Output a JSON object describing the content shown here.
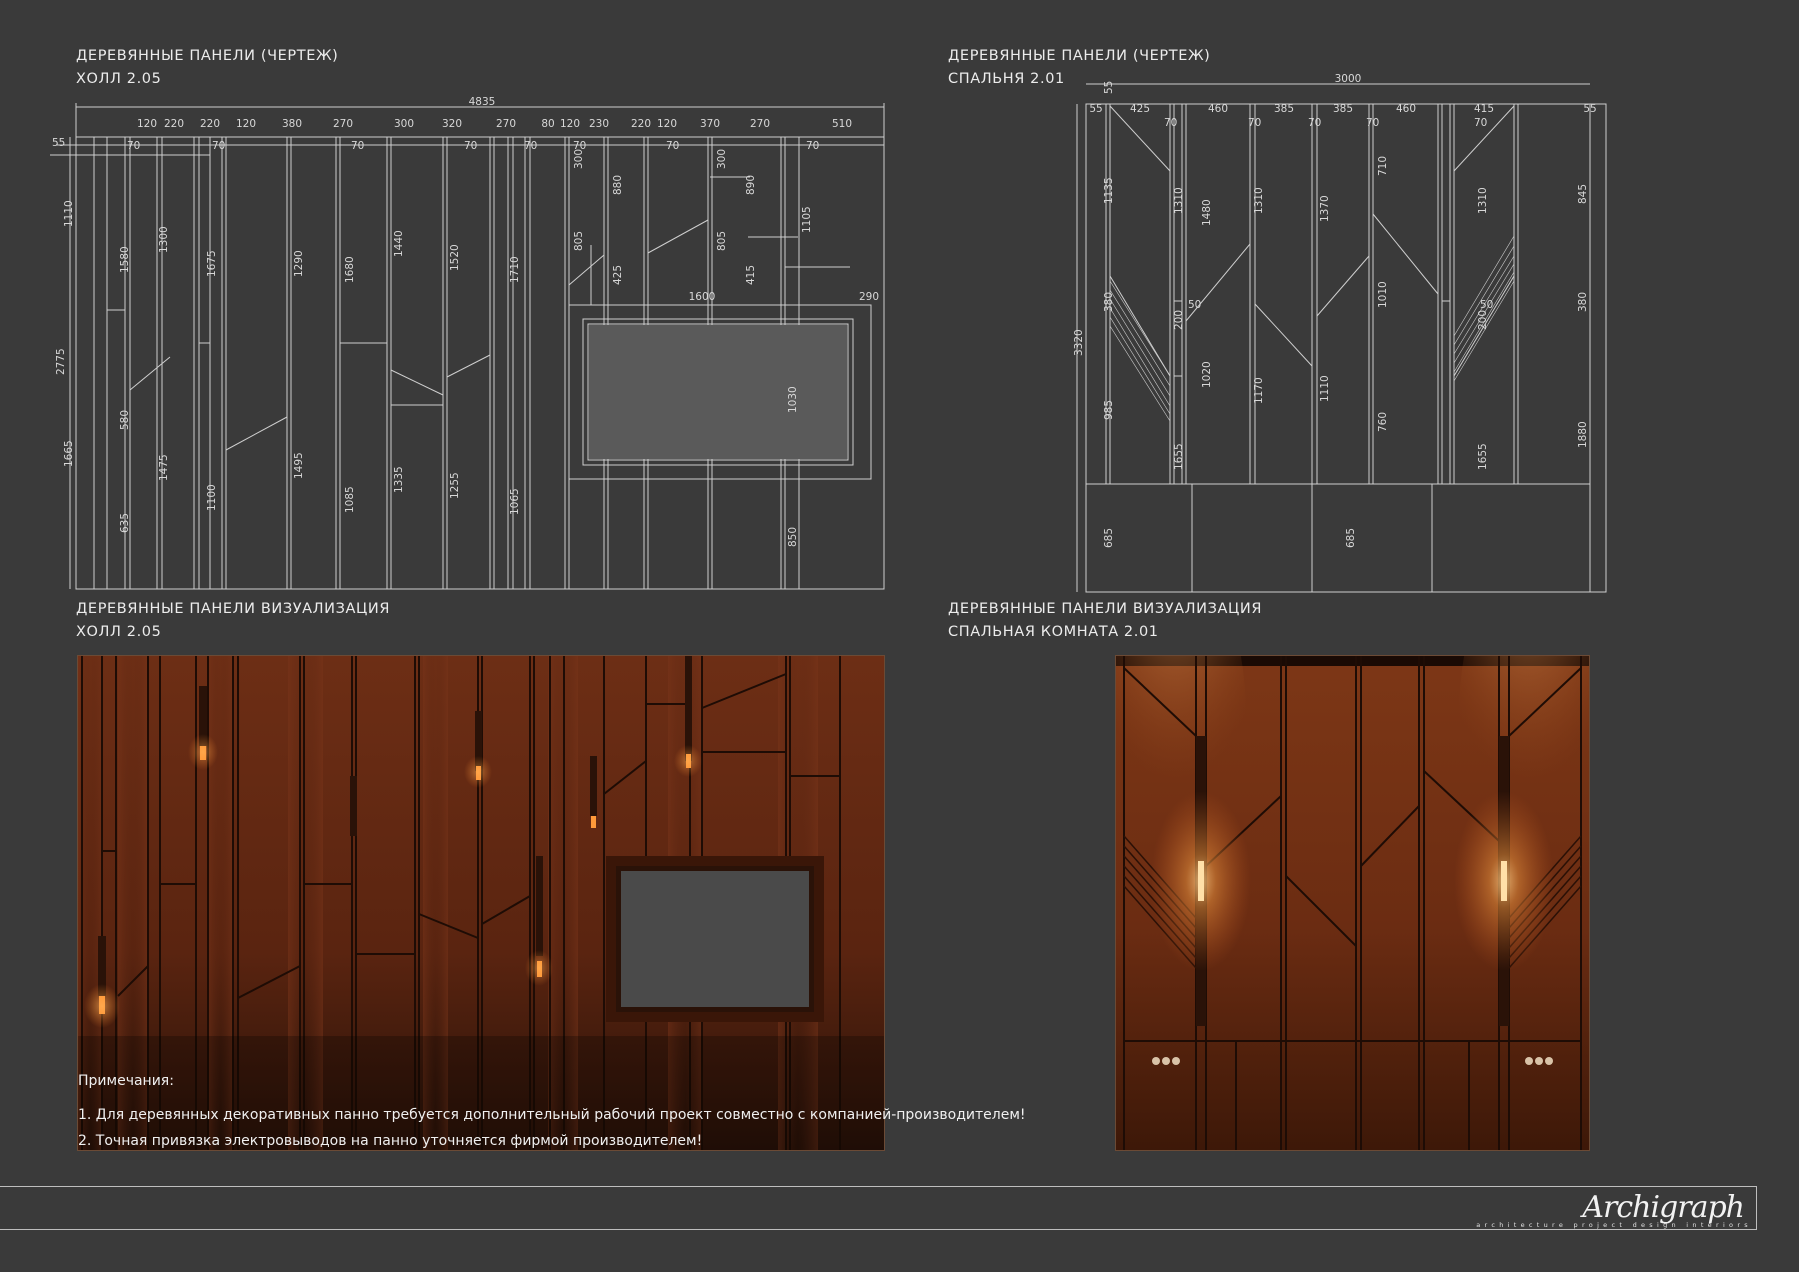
{
  "sections": {
    "hall_drawing": {
      "line1": "ДЕРЕВЯННЫЕ ПАНЕЛИ (ЧЕРТЕЖ)",
      "line2": "ХОЛЛ 2.05"
    },
    "bedroom_drawing": {
      "line1": "ДЕРЕВЯННЫЕ ПАНЕЛИ (ЧЕРТЕЖ)",
      "line2": "СПАЛЬНЯ 2.01"
    },
    "hall_visual": {
      "line1": "ДЕРЕВЯННЫЕ ПАНЕЛИ ВИЗУАЛИЗАЦИЯ",
      "line2": "ХОЛЛ 2.05"
    },
    "bedroom_visual": {
      "line1": "ДЕРЕВЯННЫЕ ПАНЕЛИ ВИЗУАЛИЗАЦИЯ",
      "line2": "СПАЛЬНАЯ КОМНАТА 2.01"
    }
  },
  "hall_dimensions": {
    "overall_width": "4835",
    "top_row": [
      "120",
      "220",
      "220",
      "120",
      "380",
      "270",
      "300",
      "320",
      "270",
      "80",
      "120",
      "230",
      "220",
      "120",
      "370",
      "270",
      "510"
    ],
    "second_row": [
      "55",
      "70",
      "70",
      "70",
      "70",
      "70",
      "70",
      "70",
      "70"
    ],
    "verticals": [
      "1110",
      "2775",
      "1665",
      "1580",
      "580",
      "635",
      "1300",
      "1475",
      "1675",
      "1100",
      "1290",
      "1495",
      "1680",
      "1085",
      "1440",
      "1335",
      "1520",
      "1255",
      "1710",
      "1065",
      "300",
      "805",
      "880",
      "425",
      "300",
      "805",
      "890",
      "415",
      "1105",
      "1030",
      "850"
    ],
    "tv_width": "1600",
    "tv_side": "290"
  },
  "bedroom_dimensions": {
    "overall_width": "3000",
    "top_row": [
      "55",
      "425",
      "460",
      "385",
      "385",
      "460",
      "415",
      "55"
    ],
    "second_row": [
      "70",
      "70",
      "70",
      "70",
      "70"
    ],
    "verticals": [
      "55",
      "1135",
      "380",
      "3320",
      "985",
      "685",
      "1310",
      "200",
      "50",
      "1480",
      "1020",
      "1655",
      "1310",
      "1170",
      "1370",
      "1110",
      "710",
      "1010",
      "760",
      "1310",
      "200",
      "50",
      "1655",
      "845",
      "380",
      "1880",
      "685"
    ]
  },
  "notes": {
    "heading": "Примечания:",
    "items": [
      "1. Для деревянных декоративных панно требуется дополнительный рабочий проект совместно с компанией-производителем!",
      "2. Точная привязка электровыводов на панно уточняется фирмой производителем!"
    ]
  },
  "brand": {
    "logo": "Archigraph",
    "tagline": "architecture project design interiors"
  },
  "colors": {
    "background": "#3a3a3a",
    "line": "#cfcfcf",
    "wood": "#6a2f18"
  }
}
